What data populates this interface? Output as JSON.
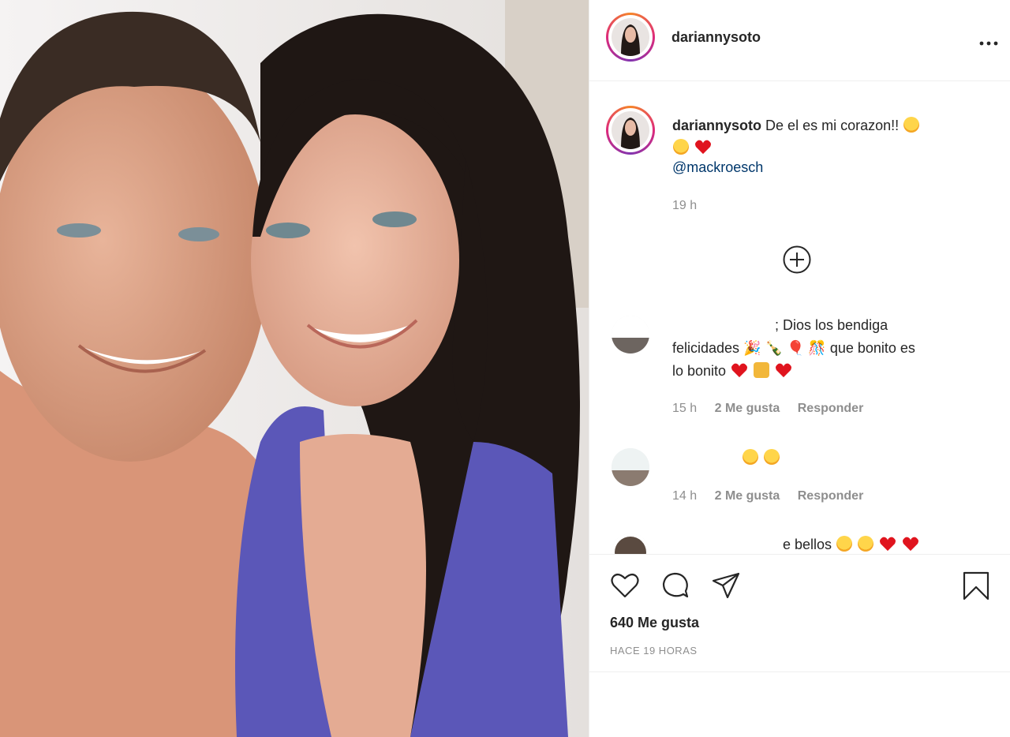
{
  "post": {
    "username": "dariannysoto",
    "more_label": "•••"
  },
  "caption": {
    "username": "dariannysoto",
    "text": "De el es mi corazon!!",
    "mention": "@mackroesch",
    "time": "19 h"
  },
  "comments": [
    {
      "line1": "; Dios los bendiga",
      "line2": "felicidades",
      "line2_tail": "que bonito es",
      "line3": "lo bonito",
      "time": "15 h",
      "likes": "2 Me gusta",
      "reply": "Responder"
    },
    {
      "time": "14 h",
      "likes": "2 Me gusta",
      "reply": "Responder"
    },
    {
      "partial": "e bellos"
    }
  ],
  "footer": {
    "likes": "640 Me gusta",
    "timestamp": "HACE 19 HORAS"
  },
  "icons": [
    "more-icon",
    "load-more-icon",
    "like-icon",
    "comment-icon",
    "share-icon",
    "save-icon"
  ],
  "colors": {
    "text": "#262626",
    "muted": "#8e8e8e",
    "mention": "#00376b",
    "border": "#efefef"
  }
}
